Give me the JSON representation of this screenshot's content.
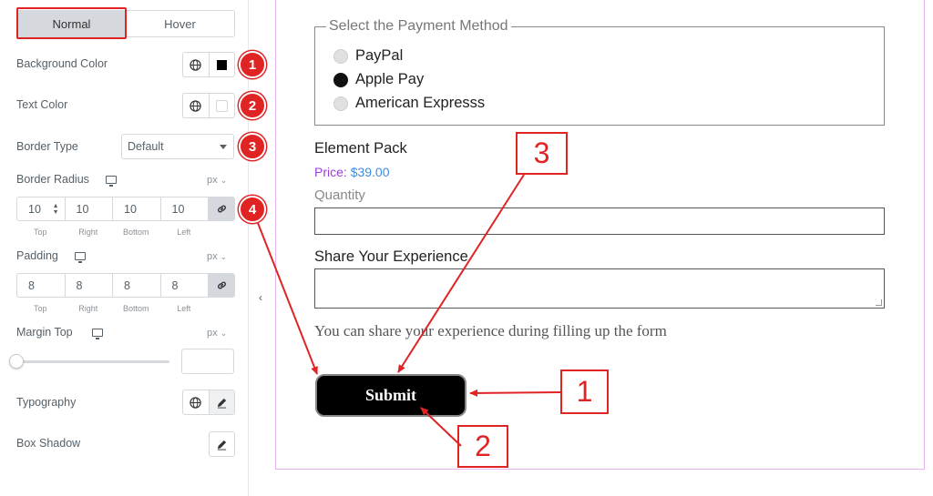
{
  "panel": {
    "tabs": [
      {
        "label": "Normal",
        "active": true
      },
      {
        "label": "Hover",
        "active": false
      }
    ],
    "background_color": {
      "label": "Background Color",
      "value": "#000000"
    },
    "text_color": {
      "label": "Text Color",
      "value": "#ffffff"
    },
    "border_type": {
      "label": "Border Type",
      "value": "Default"
    },
    "border_radius": {
      "label": "Border Radius",
      "unit": "px",
      "values": [
        "10",
        "10",
        "10",
        "10"
      ],
      "sides": [
        "Top",
        "Right",
        "Bottom",
        "Left"
      ]
    },
    "padding": {
      "label": "Padding",
      "unit": "px",
      "values": [
        "8",
        "8",
        "8",
        "8"
      ],
      "sides": [
        "Top",
        "Right",
        "Bottom",
        "Left"
      ]
    },
    "margin_top": {
      "label": "Margin Top",
      "unit": "px",
      "value": ""
    },
    "typography": {
      "label": "Typography"
    },
    "box_shadow": {
      "label": "Box Shadow"
    }
  },
  "badges": [
    "1",
    "2",
    "3",
    "4"
  ],
  "form": {
    "payment_legend": "Select the Payment Method",
    "payment_options": [
      {
        "label": "PayPal",
        "checked": false
      },
      {
        "label": "Apple Pay",
        "checked": true
      },
      {
        "label": "American Expresss",
        "checked": false
      }
    ],
    "product_title": "Element Pack",
    "price_label": "Price:",
    "price_value": "$39.00",
    "quantity_label": "Quantity",
    "share_label": "Share Your Experience",
    "help_text": "You can share your experience during filling up the form",
    "submit_label": "Submit"
  },
  "callouts": [
    "1",
    "2",
    "3"
  ],
  "colors": {
    "accent": "#e02424",
    "preview_border": "#e8b4ee",
    "price_label": "#9b3fd6",
    "price_value": "#3d8de0"
  }
}
